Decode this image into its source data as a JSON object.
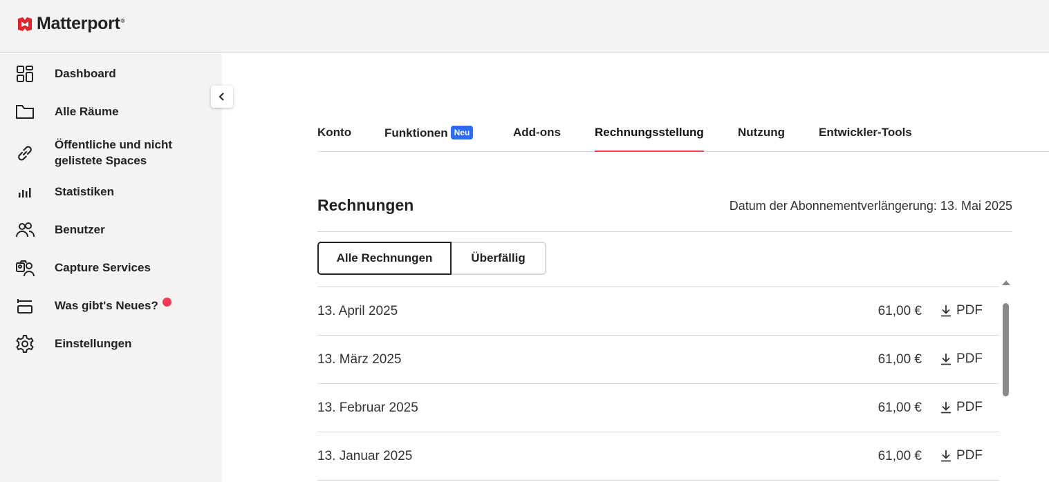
{
  "app": {
    "brand": "Matterport",
    "reg_mark": "®",
    "brand_color": "#e1242e",
    "accent": "#ef3b58"
  },
  "sidebar": {
    "items": [
      {
        "label": "Dashboard",
        "icon": "dashboard-icon"
      },
      {
        "label": "Alle Räume",
        "icon": "folder-icon"
      },
      {
        "label": "Öffentliche und nicht",
        "label2": "gelistete Spaces",
        "icon": "link-icon"
      },
      {
        "label": "Statistiken",
        "icon": "bar-chart-icon"
      },
      {
        "label": "Benutzer",
        "icon": "users-icon"
      },
      {
        "label": "Capture Services",
        "icon": "camera-person-icon"
      },
      {
        "label": "Was gibt's Neues?",
        "icon": "news-icon",
        "has_dot": true
      },
      {
        "label": "Einstellungen",
        "icon": "gear-icon"
      }
    ]
  },
  "tabs": [
    {
      "label": "Konto"
    },
    {
      "label": "Funktionen",
      "badge": "Neu"
    },
    {
      "label": "Add-ons"
    },
    {
      "label": "Rechnungsstellung",
      "active": true
    },
    {
      "label": "Nutzung"
    },
    {
      "label": "Entwickler-Tools"
    }
  ],
  "invoices": {
    "title": "Rechnungen",
    "renewal_text": "Datum der Abonnementverlängerung: 13. Mai 2025",
    "filters": {
      "all": "Alle Rechnungen",
      "overdue": "Überfällig",
      "active": "all"
    },
    "rows": [
      {
        "date": "13. April 2025",
        "amount": "61,00 €",
        "download": "PDF"
      },
      {
        "date": "13. März 2025",
        "amount": "61,00 €",
        "download": "PDF"
      },
      {
        "date": "13. Februar 2025",
        "amount": "61,00 €",
        "download": "PDF"
      },
      {
        "date": "13. Januar 2025",
        "amount": "61,00 €",
        "download": "PDF"
      }
    ]
  }
}
